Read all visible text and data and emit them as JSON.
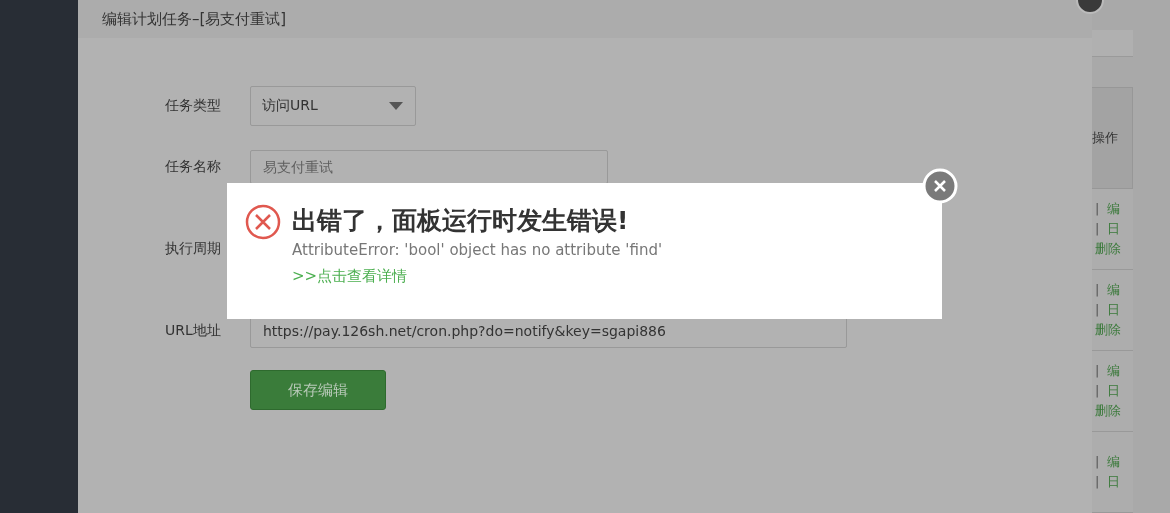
{
  "modal": {
    "title": "编辑计划任务–[易支付重试]",
    "form": [
      {
        "kind": "select",
        "label": "任务类型",
        "value": "访问URL"
      },
      {
        "kind": "input",
        "label": "任务名称",
        "placeholder": "易支付重试"
      },
      {
        "kind": "hidden",
        "label": "执行周期"
      },
      {
        "kind": "input",
        "label": "URL地址",
        "value": "https://pay.126sh.net/cron.php?do=notify&key=sgapi886"
      }
    ],
    "save_button": "保存编辑"
  },
  "error_dialog": {
    "title": "出错了，面板运行时发生错误!",
    "message": "AttributeError: 'bool' object has no attribute 'find'",
    "link": ">>点击查看详情"
  },
  "table": {
    "header": "操作",
    "rows": [
      {
        "actions": [
          {
            "sep": "|",
            "link": "编"
          },
          {
            "sep": "|",
            "link": "日"
          },
          {
            "link": "删除"
          }
        ]
      },
      {
        "actions": [
          {
            "sep": "|",
            "link": "编"
          },
          {
            "sep": "|",
            "link": "日"
          },
          {
            "link": "删除"
          }
        ]
      },
      {
        "actions": [
          {
            "sep": "|",
            "link": "编"
          },
          {
            "sep": "|",
            "link": "日"
          },
          {
            "link": "删除"
          }
        ]
      },
      {
        "actions": [
          {
            "sep": "|",
            "link": "编"
          },
          {
            "sep": "|",
            "link": "日"
          }
        ]
      }
    ]
  }
}
